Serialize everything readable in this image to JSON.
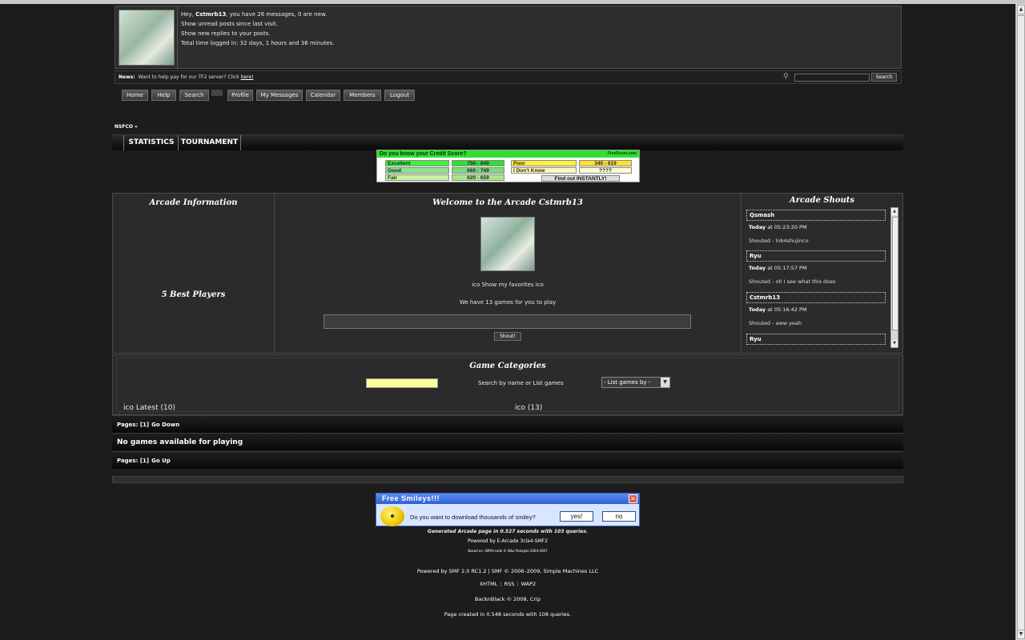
{
  "colors": {
    "page_bg": "#1c1c1c",
    "panel_bg": "#2b2b2b",
    "ad_green": "#33dd33",
    "yellow_input": "#ffff99",
    "xp_blue": "#2f5fd6"
  },
  "user_box": {
    "greeting_pre": "Hey, ",
    "username": "Cstmrb13",
    "greeting_post": ", you have 26 messages, 0 are new.",
    "unread": "Show unread posts since last visit.",
    "replies": "Show new replies to your posts.",
    "time_logged": "Total time logged in: 32 days, 1 hours and 36 minutes."
  },
  "news": {
    "label": "News:",
    "text": "Want to help pay for our TF2 server? Click ",
    "link": "here!"
  },
  "search": {
    "button": "Search",
    "icon": "magnifier-icon"
  },
  "menu": [
    "Home",
    "Help",
    "Search",
    "Profile",
    "My Messages",
    "Calendar",
    "Members",
    "Logout"
  ],
  "breadcrumb": "NSFCO »",
  "arcade_tabs": [
    "STATISTICS",
    "TOURNAMENT"
  ],
  "credit_ad": {
    "question": "Do you know your Credit Score?",
    "brand": "FreeScore.com",
    "rows": [
      {
        "label": "Excellent",
        "range": "750 - 840"
      },
      {
        "label": "Good",
        "range": "660 - 749"
      },
      {
        "label": "Fair",
        "range": "620 - 659"
      },
      {
        "label": "Poor",
        "range": "340 - 619"
      },
      {
        "label": "I Don't Know",
        "range": "????"
      }
    ],
    "cta": "Find out INSTANTLY!"
  },
  "arcade_info": {
    "title": "Arcade Information",
    "best_players": "5 Best Players"
  },
  "welcome": {
    "title": "Welcome to the Arcade Cstmrb13",
    "favorites": "ico Show my favorites ico",
    "games_count": "We have 13 games for you to play",
    "shout_button": "Shout!"
  },
  "shouts": {
    "title": "Arcade Shouts",
    "items": [
      {
        "name": "Qsmash",
        "day": "Today",
        "time": " at 05:23:20 PM",
        "msg": "Shouted - lnb4shujinco"
      },
      {
        "name": "Ryu",
        "day": "Today",
        "time": " at 05:17:57 PM",
        "msg": "Shouted - oh I see what this does"
      },
      {
        "name": "Cstmrb13",
        "day": "Today",
        "time": " at 05:16:42 PM",
        "msg": "Shouted - aww yeah"
      },
      {
        "name": "Ryu",
        "day": "",
        "time": "",
        "msg": ""
      }
    ]
  },
  "categories": {
    "title": "Game Categories",
    "search_text": "Search by name or List games",
    "list_select": "- List games by -",
    "latest": "ico Latest (10)",
    "all": "ico (13)"
  },
  "pages_top": {
    "label": "Pages: [1]",
    "link": "Go Down"
  },
  "no_games": "No games available for playing",
  "pages_bottom": {
    "label": "Pages: [1]",
    "link": "Go Up"
  },
  "smiley_ad": {
    "title": "Free Smileys!!!",
    "question": "Do you want to download thousands of smiley?",
    "yes": "yes!",
    "no": "no"
  },
  "footer": {
    "generated": "Generated Arcade page in 0.527 seconds with 103 queries.",
    "powered_arcade": "Powered by E-Arcade 3cla4-SMF2",
    "based_on": "Based on: SMFArcade © Niko Pahajoki 2004-2007",
    "powered_smf": "Powered by SMF 2.0 RC1.2 | SMF © 2006–2009, Simple Machines LLC",
    "links": [
      "XHTML",
      "RSS",
      "WAP2"
    ],
    "theme": "BacknBlack © 2008, Crip",
    "page_created": "Page created in 0.548 seconds with 108 queries."
  }
}
